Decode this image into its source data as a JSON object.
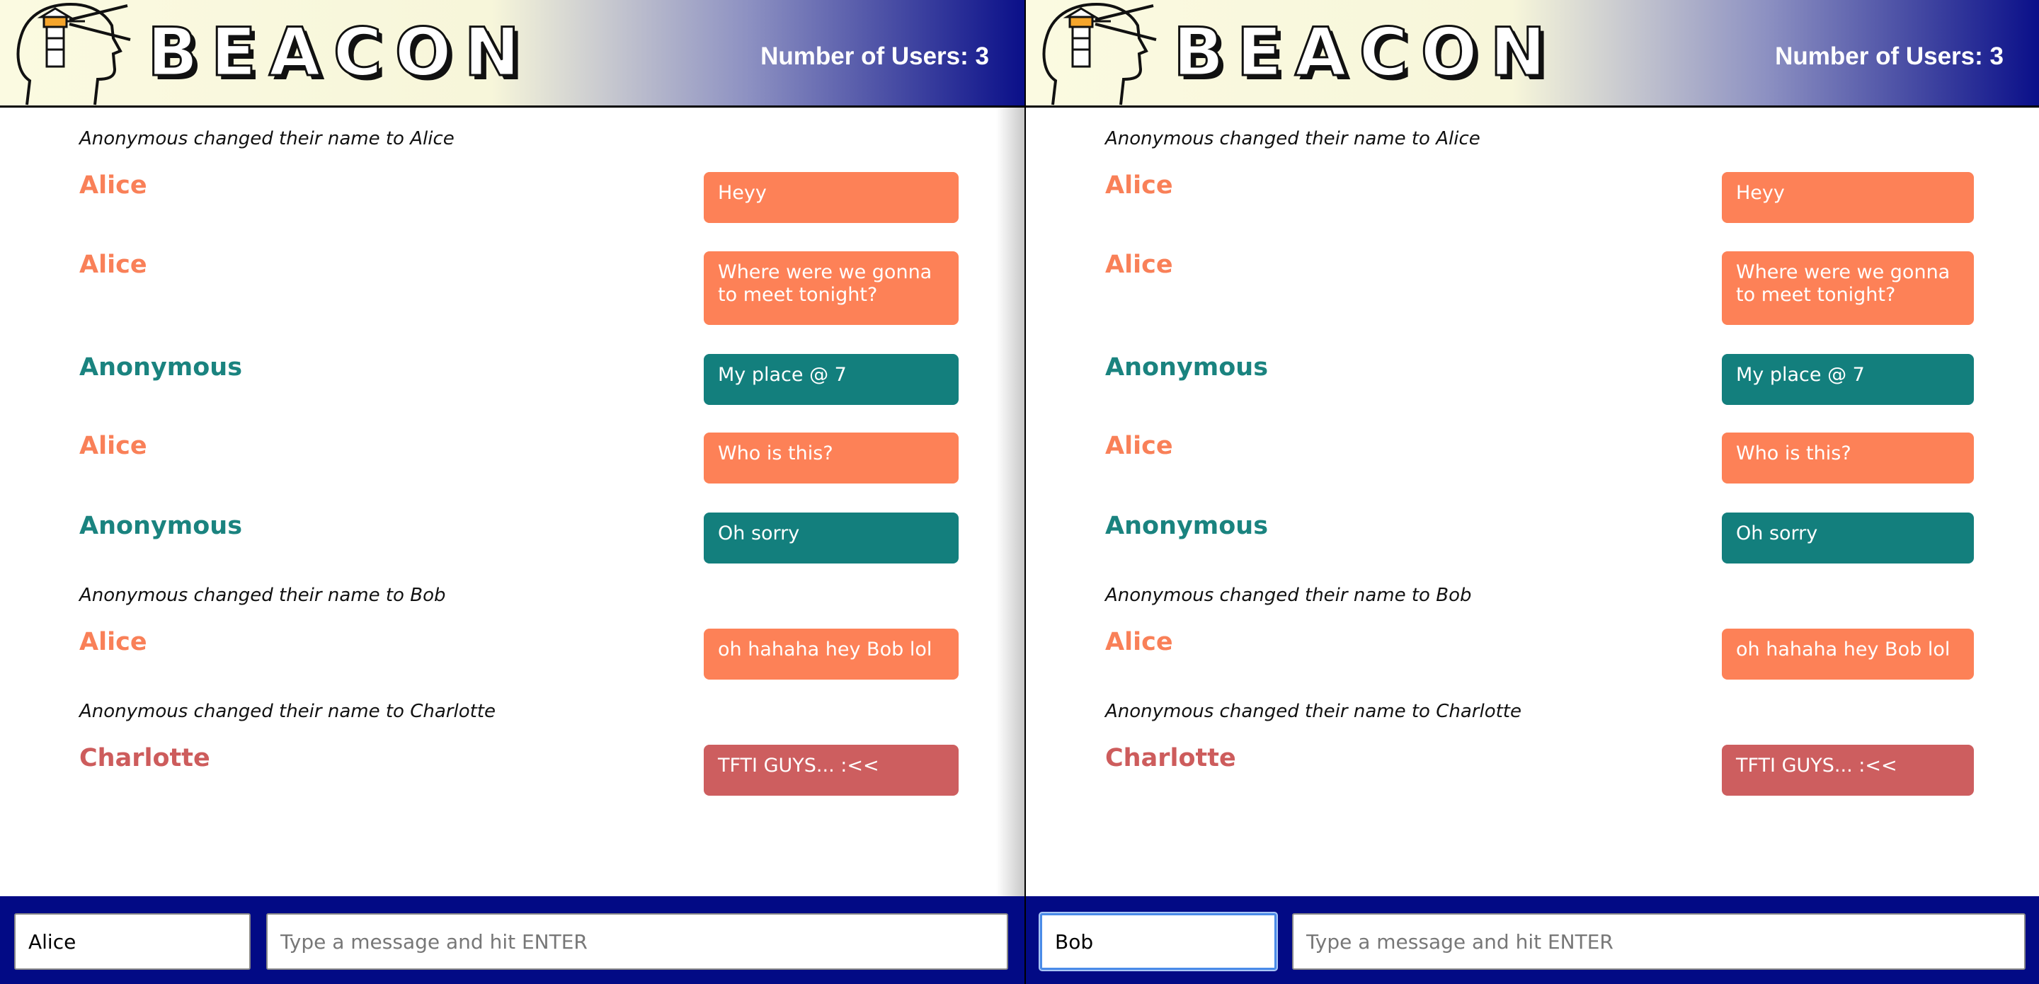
{
  "app": {
    "logo_text": "BEACON",
    "colors": {
      "alice": "#f98058",
      "anonymous": "#1a837f",
      "charlotte": "#cd5c5c",
      "footer": "#020a85",
      "header_dark": "#0a0f89"
    }
  },
  "left_pane": {
    "user_count": "Number of Users: 3",
    "messages": [
      {
        "type": "system",
        "text": "Anonymous changed their name to Alice"
      },
      {
        "type": "chat",
        "author": "Alice",
        "text": "Heyy"
      },
      {
        "type": "chat",
        "author": "Alice",
        "text": "Where were we gonna to meet tonight?"
      },
      {
        "type": "chat",
        "author": "Anonymous",
        "text": "My place @ 7"
      },
      {
        "type": "chat",
        "author": "Alice",
        "text": "Who is this?"
      },
      {
        "type": "chat",
        "author": "Anonymous",
        "text": "Oh sorry"
      },
      {
        "type": "system",
        "text": "Anonymous changed their name to Bob"
      },
      {
        "type": "chat",
        "author": "Alice",
        "text": "oh hahaha hey Bob lol"
      },
      {
        "type": "system",
        "text": "Anonymous changed their name to Charlotte"
      },
      {
        "type": "chat",
        "author": "Charlotte",
        "text": "TFTI GUYS... :<<"
      }
    ],
    "name_value": "Alice",
    "message_placeholder": "Type a message and hit ENTER"
  },
  "right_pane": {
    "user_count": "Number of Users: 3",
    "messages": [
      {
        "type": "system",
        "text": "Anonymous changed their name to Alice"
      },
      {
        "type": "chat",
        "author": "Alice",
        "text": "Heyy"
      },
      {
        "type": "chat",
        "author": "Alice",
        "text": "Where were we gonna to meet tonight?"
      },
      {
        "type": "chat",
        "author": "Anonymous",
        "text": "My place @ 7"
      },
      {
        "type": "chat",
        "author": "Alice",
        "text": "Who is this?"
      },
      {
        "type": "chat",
        "author": "Anonymous",
        "text": "Oh sorry"
      },
      {
        "type": "system",
        "text": "Anonymous changed their name to Bob"
      },
      {
        "type": "chat",
        "author": "Alice",
        "text": "oh hahaha hey Bob lol"
      },
      {
        "type": "system",
        "text": "Anonymous changed their name to Charlotte"
      },
      {
        "type": "chat",
        "author": "Charlotte",
        "text": "TFTI GUYS... :<<"
      }
    ],
    "name_value": "Bob",
    "message_placeholder": "Type a message and hit ENTER"
  }
}
